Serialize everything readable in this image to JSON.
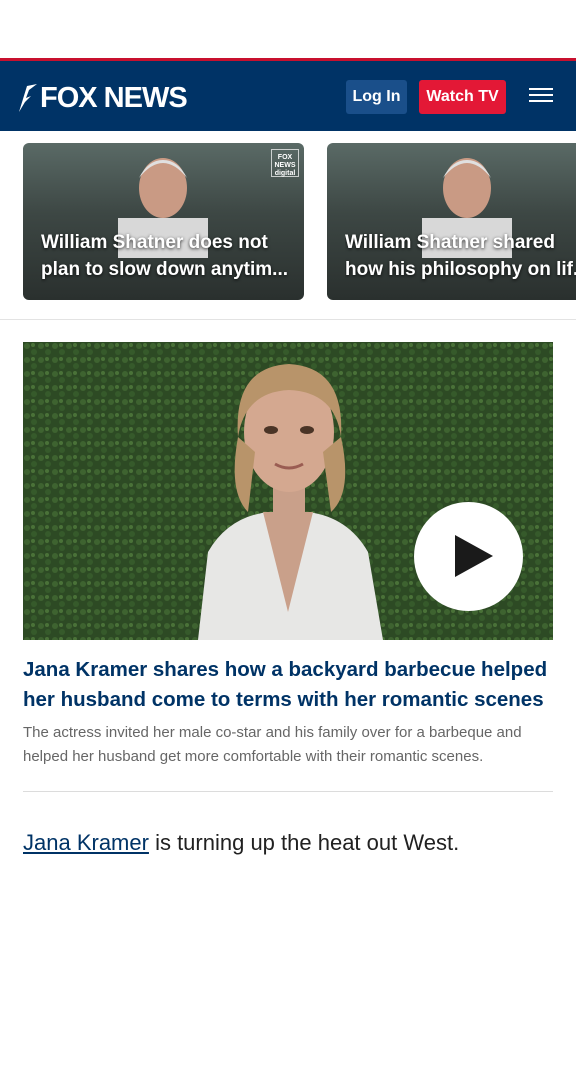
{
  "header": {
    "brand": "FOX NEWS",
    "login_label": "Log In",
    "watch_label": "Watch TV"
  },
  "carousel": {
    "items": [
      {
        "line1": "William Shatner does not",
        "line2": "plan to slow down anytim..."
      },
      {
        "line1": "William Shatner shared",
        "line2": "how his philosophy on lif..."
      }
    ],
    "watermark": "FOX NEWS digital"
  },
  "video": {
    "headline": "Jana Kramer shares how a backyard barbecue helped her husband come to terms with her romantic scenes",
    "dek": "The actress invited her male co-star and his family over for a barbeque and helped her husband get more comfortable with their romantic scenes."
  },
  "article": {
    "link_text": "Jana Kramer",
    "text": " is turning up the heat out West."
  },
  "colors": {
    "header_bg": "#003366",
    "accent_red": "#e31836",
    "headline_blue": "#003366"
  }
}
